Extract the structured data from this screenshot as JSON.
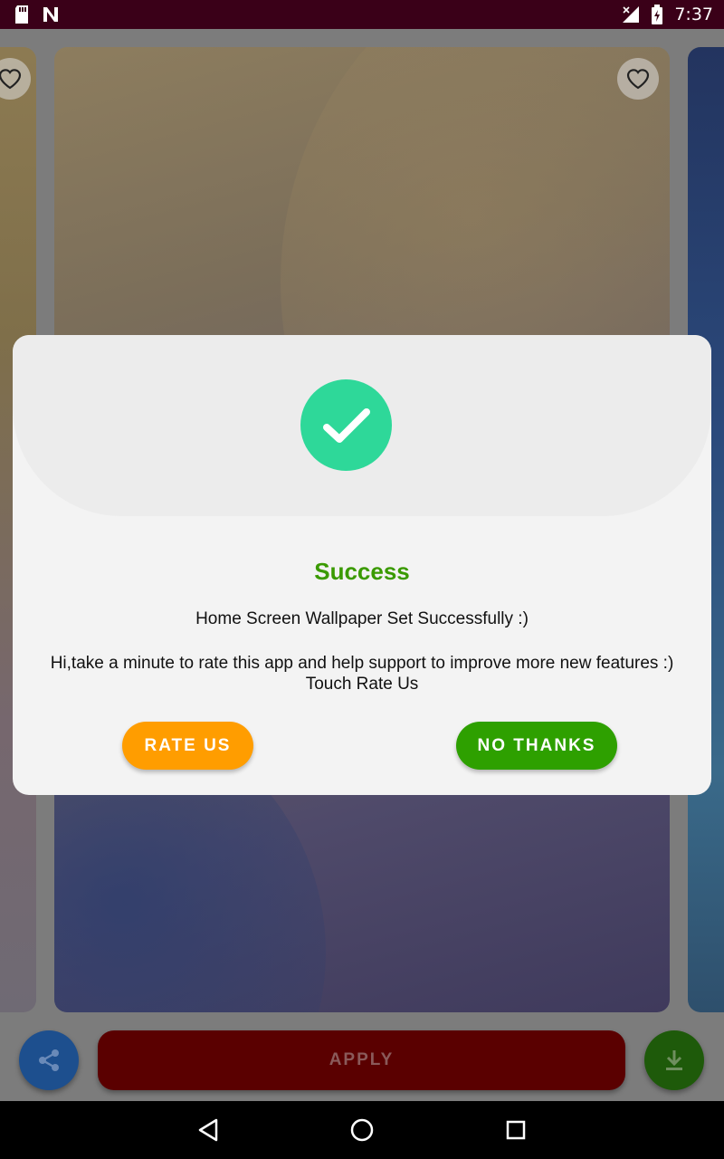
{
  "status_bar": {
    "time": "7:37",
    "icons": [
      "sd-card-icon",
      "n-notification-icon",
      "signal-icon",
      "battery-icon"
    ]
  },
  "app": {
    "apply_label": "APPLY",
    "icons": [
      "share-icon",
      "download-icon",
      "heart-icon"
    ]
  },
  "dialog": {
    "title": "Success",
    "message": "Home Screen Wallpaper Set Successfully :)",
    "prompt_line1": "Hi,take a minute to rate this app and help support to improve more new features :)",
    "prompt_line2": "Touch Rate Us",
    "rate_label": "RATE US",
    "no_thanks_label": "NO THANKS",
    "colors": {
      "check": "#2ed899",
      "title": "#3a9a00",
      "rate_button": "#ff9d00",
      "no_thanks_button": "#2ea000"
    }
  },
  "nav_bar": {
    "icons": [
      "back-icon",
      "home-icon",
      "recents-icon"
    ]
  }
}
